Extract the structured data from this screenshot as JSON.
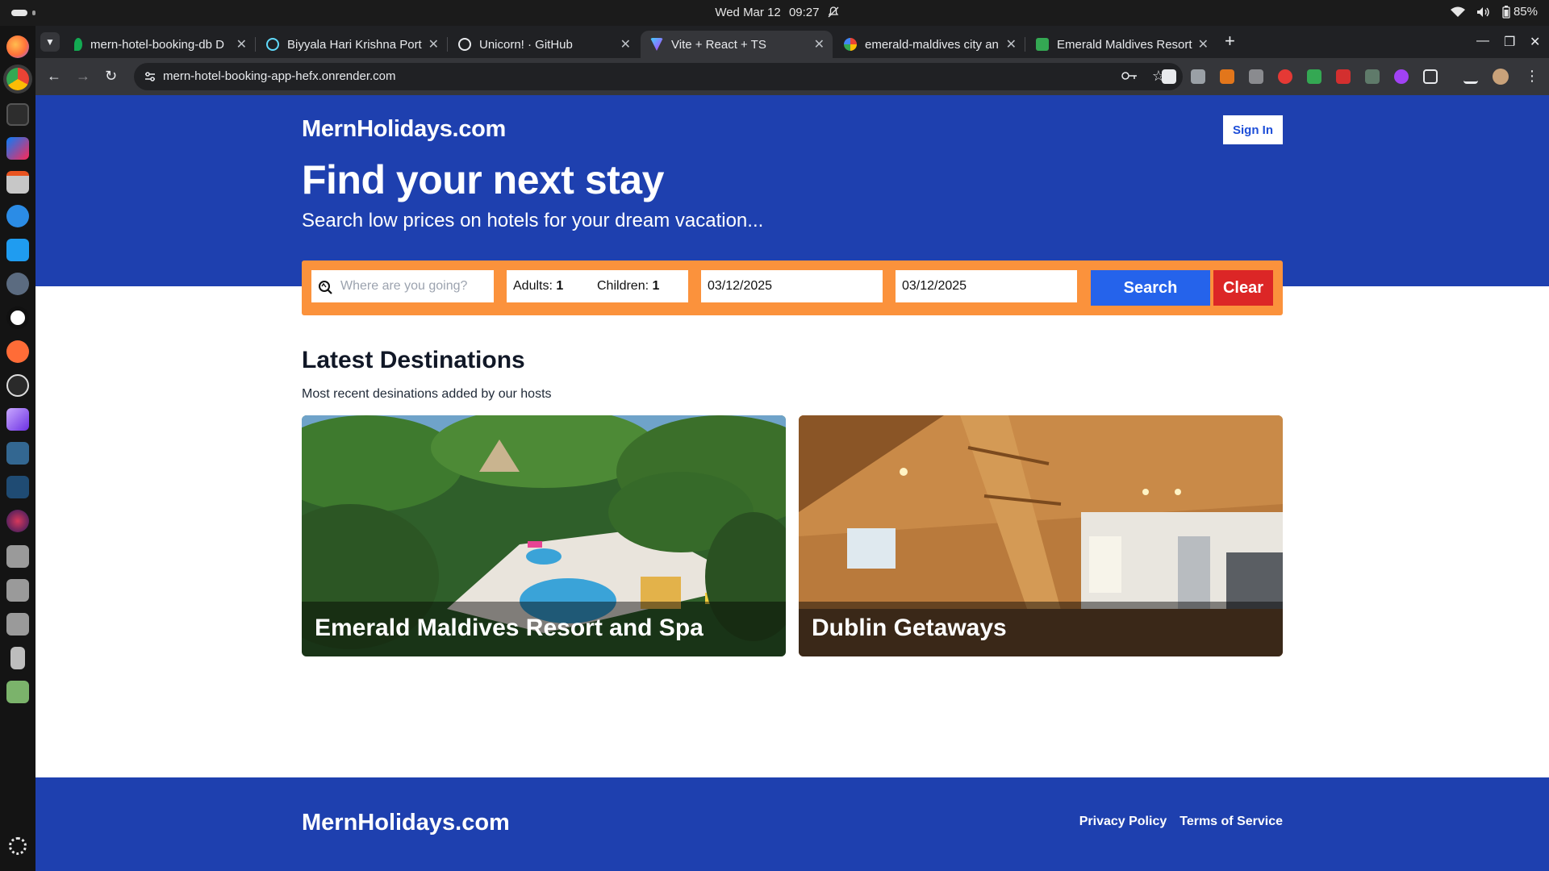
{
  "system_bar": {
    "date": "Wed Mar 12",
    "time": "09:27",
    "battery": "85%"
  },
  "browser": {
    "tabs": [
      {
        "title": "mern-hotel-booking-db D",
        "favicon": "mongodb-leaf-icon",
        "color": "#13aa52"
      },
      {
        "title": "Biyyala Hari Krishna Port",
        "favicon": "react-icon",
        "color": "#61dafb"
      },
      {
        "title": "Unicorn! · GitHub",
        "favicon": "github-icon",
        "color": "#ffffff"
      },
      {
        "title": "Vite + React + TS",
        "favicon": "vite-icon",
        "color": "#a855f7"
      },
      {
        "title": "emerald-maldives city an",
        "favicon": "google-icon",
        "color": "#4285f4"
      },
      {
        "title": "Emerald Maldives Resort",
        "favicon": "resort-icon",
        "color": "#34a853"
      }
    ],
    "url": "mern-hotel-booking-app-hefx.onrender.com"
  },
  "header": {
    "logo": "MernHolidays.com",
    "sign_in": "Sign In"
  },
  "hero": {
    "headline": "Find your next stay",
    "subline": "Search low prices on hotels for your dream vacation..."
  },
  "search": {
    "destination_placeholder": "Where are you going?",
    "adults_label": "Adults:",
    "adults": "1",
    "children_label": "Children:",
    "children": "1",
    "check_in": "03/12/2025",
    "check_out": "03/12/2025",
    "search_label": "Search",
    "clear_label": "Clear"
  },
  "destinations": {
    "title": "Latest Destinations",
    "subtitle": "Most recent desinations added by our hosts",
    "cards": [
      {
        "name": "Emerald Maldives Resort and Spa"
      },
      {
        "name": "Dublin Getaways"
      }
    ]
  },
  "footer": {
    "logo": "MernHolidays.com",
    "links": [
      "Privacy Policy",
      "Terms of Service"
    ]
  },
  "colors": {
    "brand_blue": "#1e40af",
    "search_orange": "#fb923c",
    "search_button": "#2563eb",
    "clear_button": "#dc2626"
  }
}
